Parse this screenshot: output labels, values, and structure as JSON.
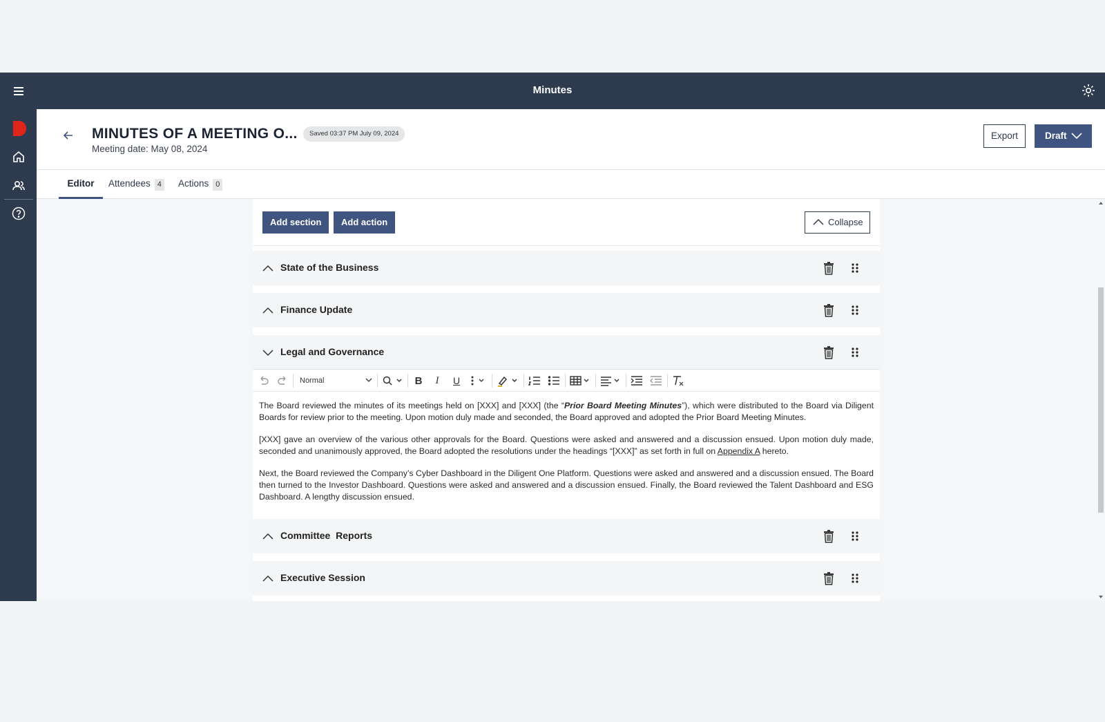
{
  "topbar": {
    "title": "Minutes",
    "menu_icon": "menu-icon",
    "settings_icon": "settings-icon"
  },
  "rail": {
    "items": [
      {
        "name": "home-icon"
      },
      {
        "name": "users-icon"
      },
      {
        "name": "help-icon"
      }
    ],
    "brand_color": "#e0251b"
  },
  "header": {
    "title": "MINUTES OF A MEETING O...",
    "saved_badge": "Saved 03:37 PM July 09, 2024",
    "meeting_date": "Meeting date: May 08, 2024",
    "export_label": "Export",
    "draft_label": "Draft"
  },
  "tabs": [
    {
      "label": "Editor",
      "active": true
    },
    {
      "label": "Attendees",
      "count": "4"
    },
    {
      "label": "Actions",
      "count": "0"
    }
  ],
  "actions": {
    "add_section": "Add section",
    "add_action": "Add action",
    "collapse": "Collapse"
  },
  "sections": [
    {
      "title": "State of the Business",
      "expanded": false
    },
    {
      "title": "Finance Update",
      "expanded": false
    },
    {
      "title": "Legal and Governance",
      "expanded": true
    },
    {
      "title": "Committee  Reports",
      "expanded": false
    },
    {
      "title": "Executive Session",
      "expanded": false
    }
  ],
  "toolbar": {
    "format": "Normal"
  },
  "editor": {
    "p1_a": "The Board reviewed the minutes of its meetings held on [XXX] and [XXX] (the “",
    "p1_b": "Prior Board Meeting Minutes",
    "p1_c": "”), which were distributed to the Board via Diligent Boards for review prior to the meeting. Upon motion duly made and seconded, the Board approved and adopted the Prior Board Meeting Minutes.",
    "p2_a": "[XXX] gave an overview of the various other approvals for the Board. Questions were asked and answered and a discussion ensued. Upon motion duly made, seconded and unanimously approved, the Board adopted the resolutions under the headings “[XXX]” as set forth in full on ",
    "p2_b": "Appendix A",
    "p2_c": " hereto.",
    "p3": "Next, the Board reviewed the Company’s Cyber Dashboard in the Diligent One Platform. Questions were asked and answered and a discussion ensued. The Board then turned to the Investor Dashboard. Questions were asked and answered and a discussion ensued. Finally, the Board reviewed the Talent Dashboard and ESG Dashboard. A lengthy discussion ensued."
  }
}
